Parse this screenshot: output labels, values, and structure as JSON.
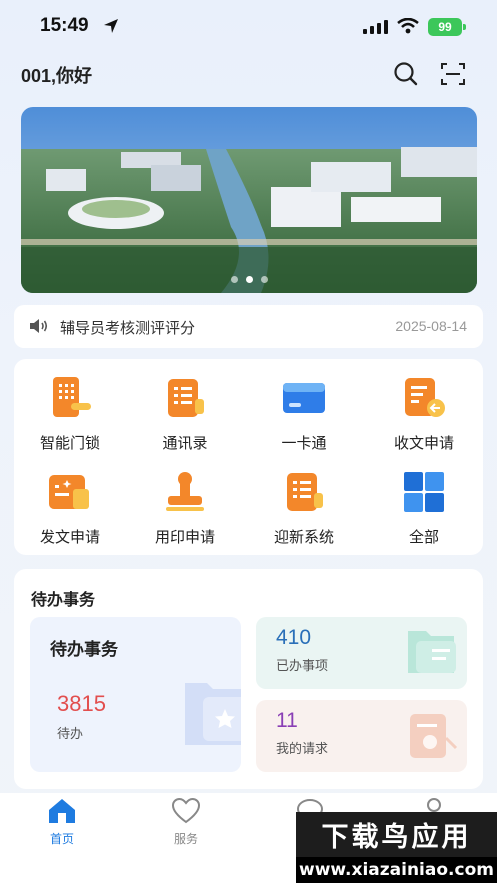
{
  "status_bar": {
    "time": "15:49",
    "battery": "99"
  },
  "header": {
    "greeting": "001,你好"
  },
  "notice": {
    "text": "辅导员考核测评评分",
    "date": "2025-08-14"
  },
  "apps": [
    {
      "label": "智能门锁",
      "icon": "door-lock-icon"
    },
    {
      "label": "通讯录",
      "icon": "contacts-icon"
    },
    {
      "label": "一卡通",
      "icon": "campus-card-icon"
    },
    {
      "label": "收文申请",
      "icon": "receive-doc-icon"
    },
    {
      "label": "发文申请",
      "icon": "send-doc-icon"
    },
    {
      "label": "用印申请",
      "icon": "seal-icon"
    },
    {
      "label": "迎新系统",
      "icon": "welcome-system-icon"
    },
    {
      "label": "全部",
      "icon": "all-apps-icon"
    }
  ],
  "todo": {
    "section_title": "待办事务",
    "main": {
      "title": "待办事务",
      "count": "3815",
      "label": "待办"
    },
    "done": {
      "count": "410",
      "label": "已办事项"
    },
    "requests": {
      "count": "11",
      "label": "我的请求"
    }
  },
  "tabbar": {
    "items": [
      {
        "label": "首页",
        "active": true
      },
      {
        "label": "服务",
        "active": false
      }
    ]
  },
  "watermark": {
    "line1": "下载鸟应用",
    "line2": "www.xiazainiao.com"
  },
  "colors": {
    "accent": "#1e7be0",
    "todo_count": "#e24e4e",
    "done_count": "#2a6fb8",
    "req_count": "#8a3fb5"
  }
}
